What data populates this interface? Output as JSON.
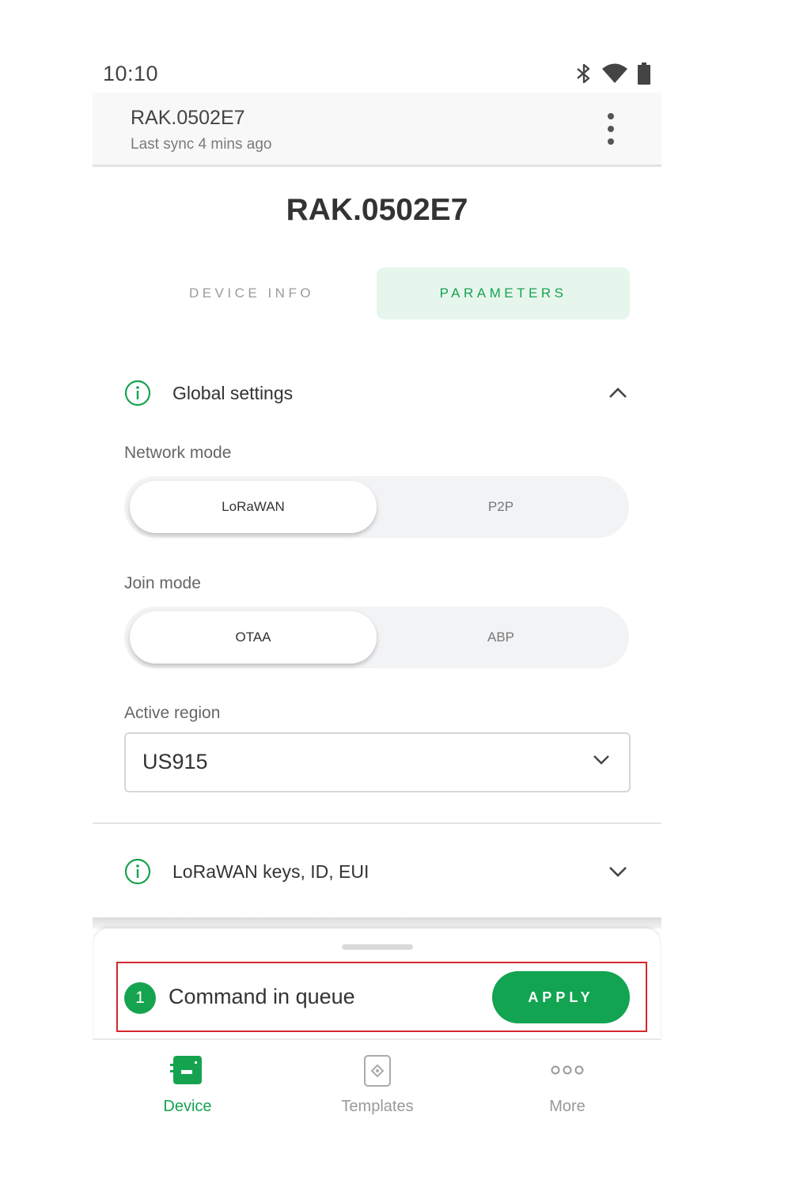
{
  "status_bar": {
    "time": "10:10"
  },
  "header": {
    "title": "RAK.0502E7",
    "subtitle": "Last sync 4 mins ago"
  },
  "device_title": "RAK.0502E7",
  "tabs": [
    {
      "label": "DEVICE INFO",
      "active": false
    },
    {
      "label": "PARAMETERS",
      "active": true
    }
  ],
  "global_settings": {
    "title": "Global settings",
    "network_mode": {
      "label": "Network mode",
      "options": [
        "LoRaWAN",
        "P2P"
      ],
      "selected": "LoRaWAN"
    },
    "join_mode": {
      "label": "Join mode",
      "options": [
        "OTAA",
        "ABP"
      ],
      "selected": "OTAA"
    },
    "active_region": {
      "label": "Active region",
      "value": "US915"
    }
  },
  "lorawan_section": {
    "title": "LoRaWAN keys, ID, EUI"
  },
  "queue": {
    "count": "1",
    "text": "Command in queue",
    "apply_label": "APPLY"
  },
  "bottom_nav": [
    {
      "label": "Device",
      "icon": "device-icon",
      "active": true
    },
    {
      "label": "Templates",
      "icon": "templates-icon",
      "active": false
    },
    {
      "label": "More",
      "icon": "more-icon",
      "active": false
    }
  ],
  "colors": {
    "accent": "#16a34f",
    "accent_light": "#e6f6ec",
    "highlight_border": "#d7262f"
  }
}
